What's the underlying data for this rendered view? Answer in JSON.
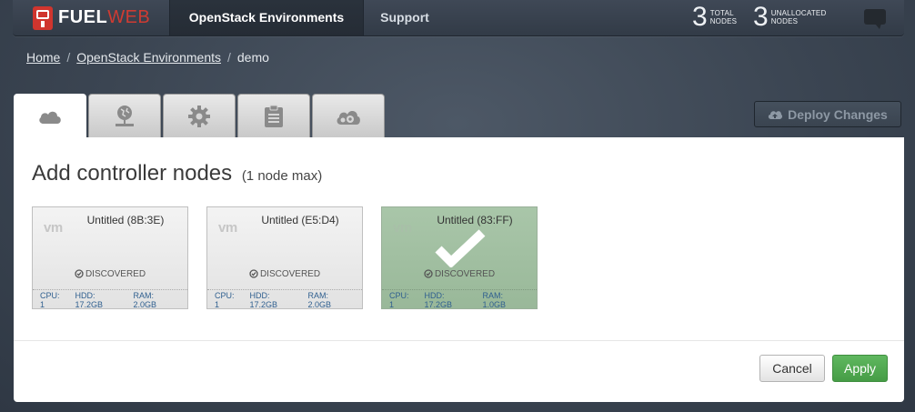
{
  "navbar": {
    "brand_fuel": "FUEL",
    "brand_web": "WEB",
    "links": [
      {
        "label": "OpenStack Environments",
        "active": true
      },
      {
        "label": "Support",
        "active": false
      }
    ],
    "stats": [
      {
        "number": "3",
        "label_line1": "TOTAL",
        "label_line2": "NODES"
      },
      {
        "number": "3",
        "label_line1": "UNALLOCATED",
        "label_line2": "NODES"
      }
    ]
  },
  "breadcrumb": {
    "home": "Home",
    "environments": "OpenStack Environments",
    "current": "demo",
    "separator": "/"
  },
  "tabs": [
    {
      "icon": "cloud-icon",
      "active": true
    },
    {
      "icon": "network-icon",
      "active": false
    },
    {
      "icon": "gear-icon",
      "active": false
    },
    {
      "icon": "clipboard-icon",
      "active": false
    },
    {
      "icon": "cloud-gear-icon",
      "active": false
    }
  ],
  "deploy_button": "Deploy Changes",
  "panel": {
    "title": "Add controller nodes",
    "subtitle": "(1 node max)",
    "nodes": [
      {
        "name": "Untitled (8B:3E)",
        "status": "DISCOVERED",
        "cpu": "CPU: 1",
        "hdd": "HDD: 17.2GB",
        "ram": "RAM: 2.0GB",
        "selected": false
      },
      {
        "name": "Untitled (E5:D4)",
        "status": "DISCOVERED",
        "cpu": "CPU: 1",
        "hdd": "HDD: 17.2GB",
        "ram": "RAM: 2.0GB",
        "selected": false
      },
      {
        "name": "Untitled (83:FF)",
        "status": "DISCOVERED",
        "cpu": "CPU: 1",
        "hdd": "HDD: 17.2GB",
        "ram": "RAM: 1.0GB",
        "selected": true
      }
    ],
    "vm_label": "vm",
    "cancel": "Cancel",
    "apply": "Apply"
  },
  "colors": {
    "brand_red": "#cf3b32",
    "apply_green": "#4cae4c",
    "selected_node": "#a3c1a3",
    "spec_text": "#2f5f8f"
  }
}
